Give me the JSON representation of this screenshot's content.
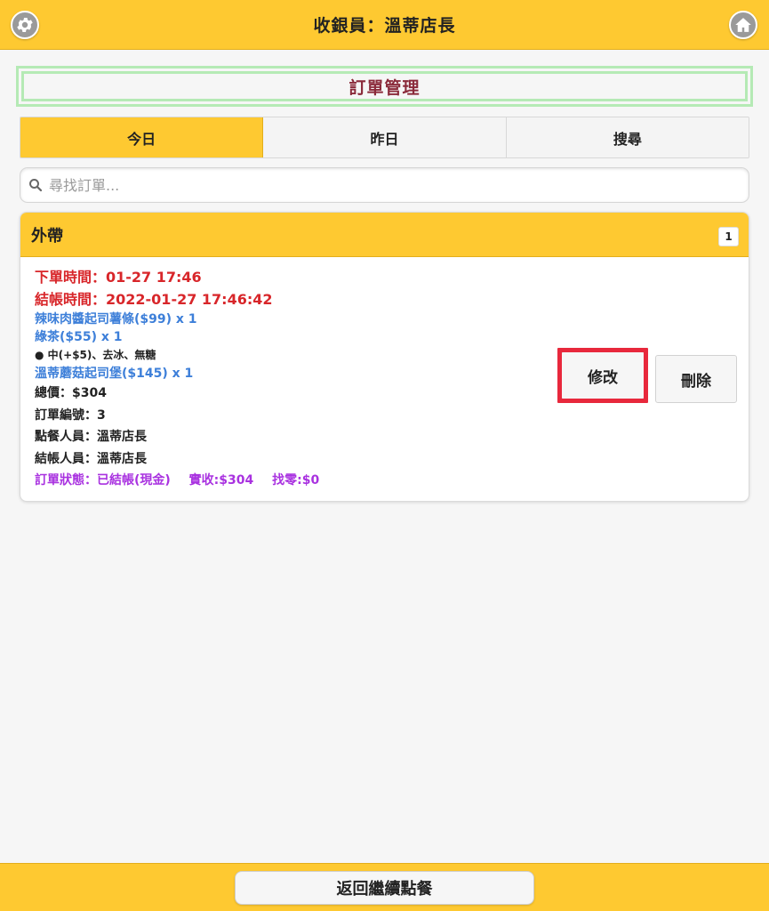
{
  "header": {
    "title": "收銀員：溫蒂店長",
    "left_icon": "gear-icon",
    "right_icon": "home-icon"
  },
  "page": {
    "title": "訂單管理"
  },
  "tabs": [
    {
      "label": "今日",
      "active": true
    },
    {
      "label": "昨日",
      "active": false
    },
    {
      "label": "搜尋",
      "active": false
    }
  ],
  "search": {
    "placeholder": "尋找訂單..."
  },
  "order_group": {
    "title": "外帶",
    "count": "1",
    "order": {
      "order_time": "下單時間：01-27 17:46",
      "checkout_time": "結帳時間：2022-01-27 17:46:42",
      "items": [
        {
          "text": "辣味肉醬起司薯條($99) x 1"
        },
        {
          "text": "綠茶($55) x 1",
          "options": "● 中(+$5)、去冰、無糖"
        },
        {
          "text": "溫蒂蘑菇起司堡($145) x 1"
        }
      ],
      "total": "總價：$304",
      "order_number": "訂單編號：3",
      "staff_order": "點餐人員：溫蒂店長",
      "staff_checkout": "結帳人員：溫蒂店長",
      "status": "訂單狀態：已結帳(現金)",
      "received": "實收:$304",
      "change": "找零:$0",
      "edit_label": "修改",
      "delete_label": "刪除"
    }
  },
  "footer": {
    "back_label": "返回繼續點餐"
  },
  "colors": {
    "accent": "#fec931",
    "time_text": "#d8262a",
    "item_text": "#3d7fd9",
    "status_text": "#a932e0",
    "highlight": "#e8283c"
  }
}
